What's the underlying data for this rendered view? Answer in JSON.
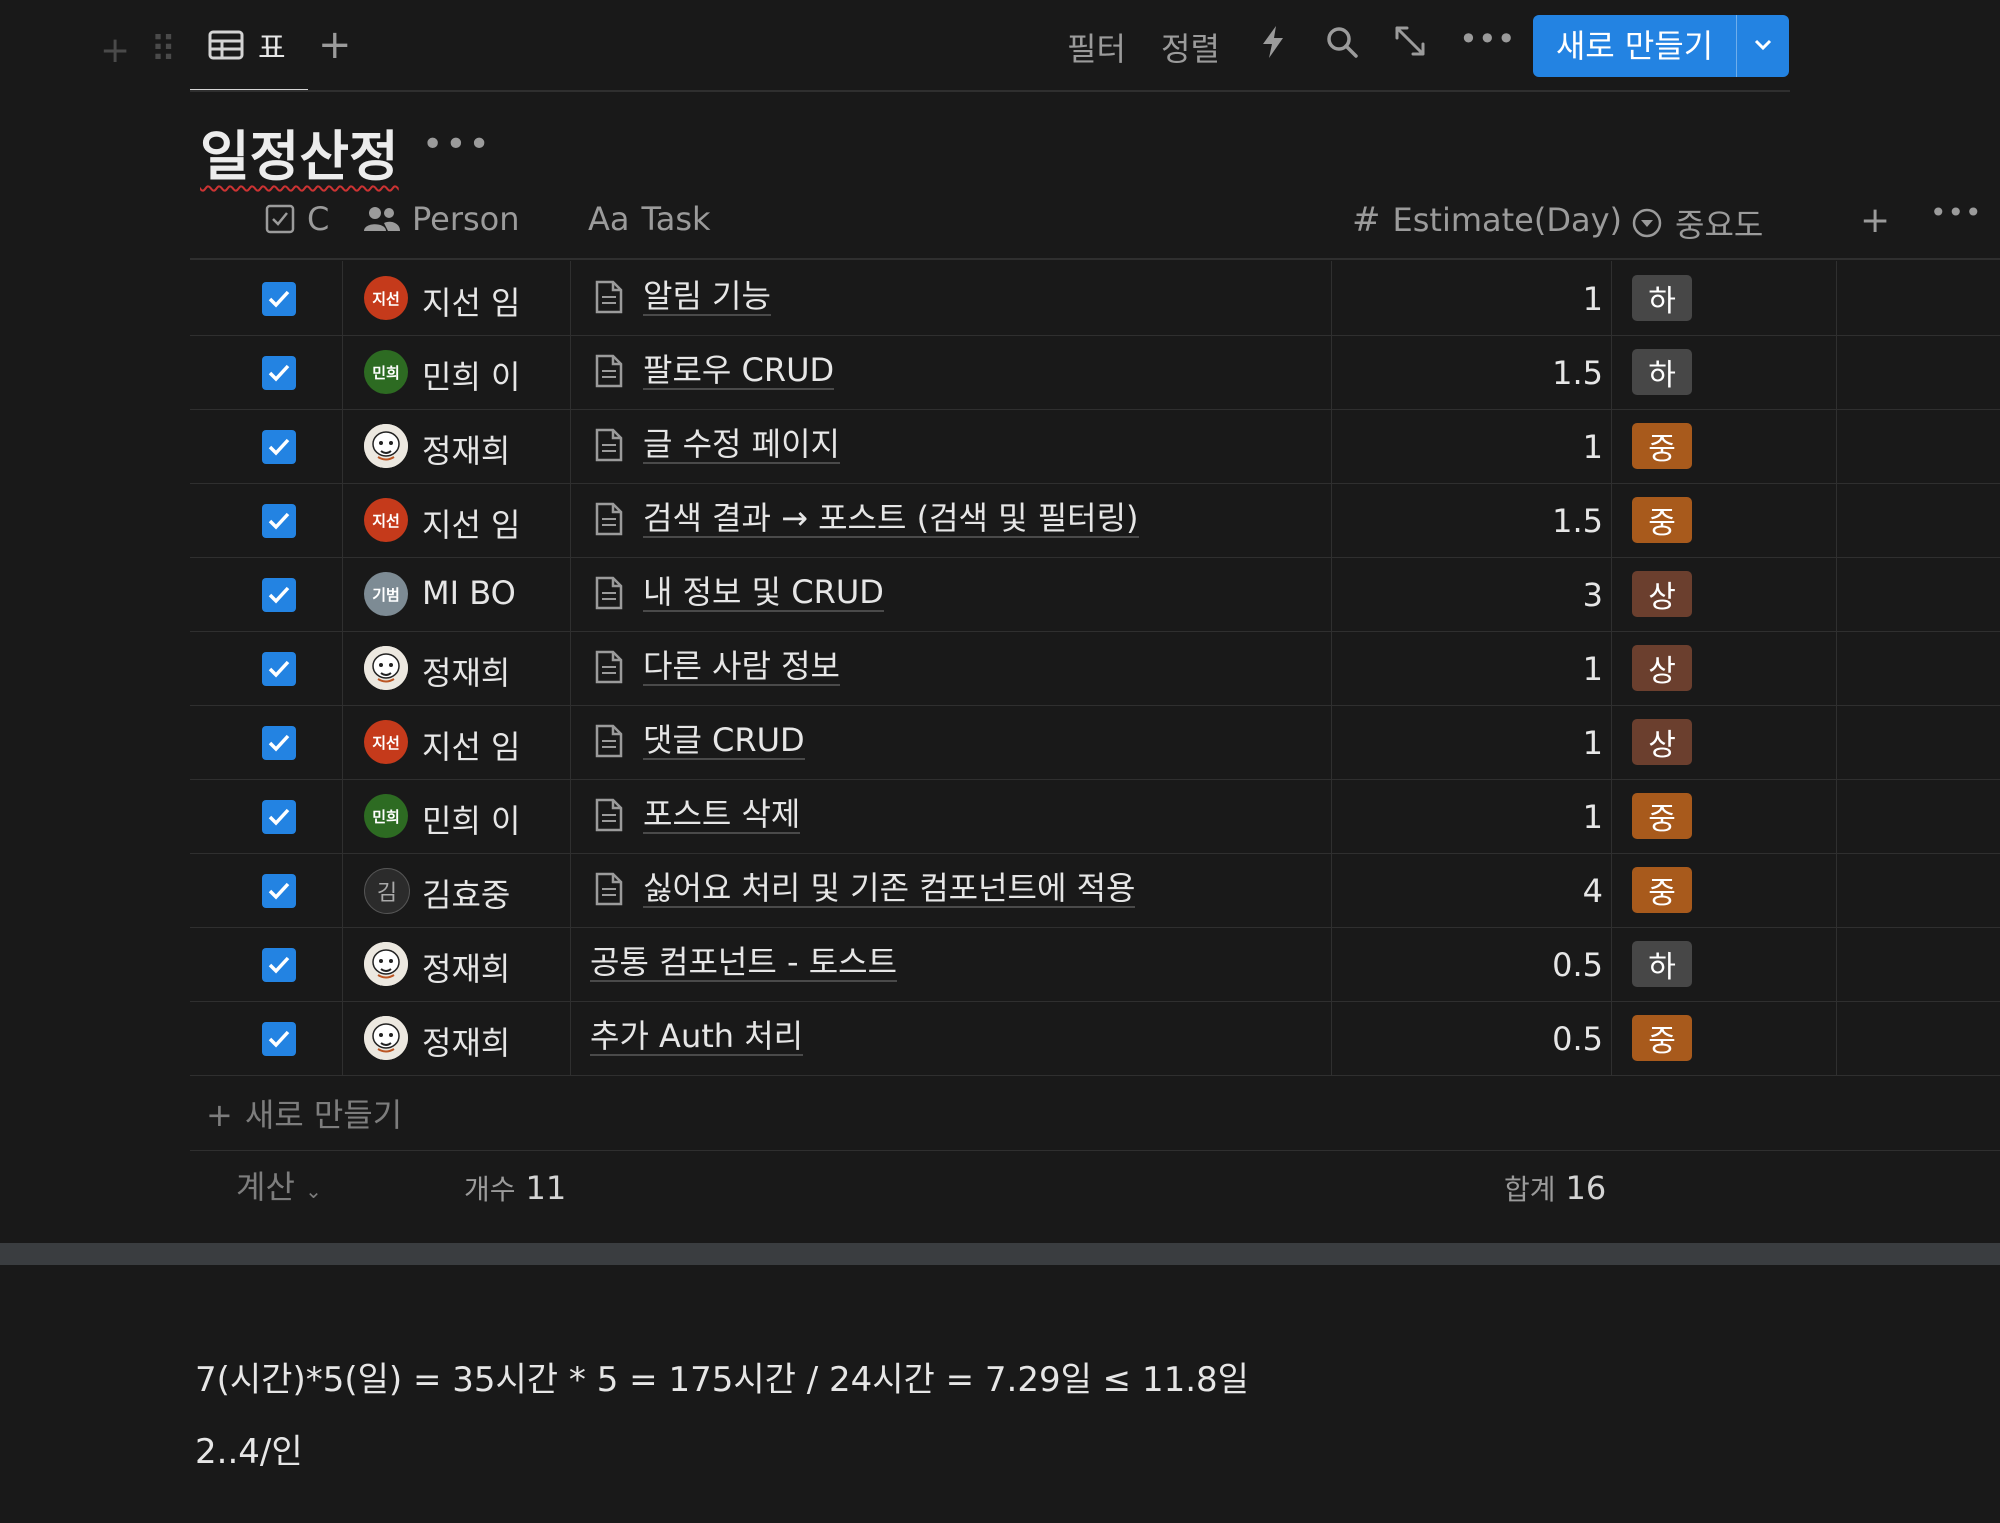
{
  "toolbar": {
    "view_label": "표",
    "filter_label": "필터",
    "sort_label": "정렬",
    "new_label": "새로 만들기"
  },
  "database": {
    "title": "일정산정"
  },
  "columns": {
    "check": "C",
    "person": "Person",
    "task_prefix": "Aa",
    "task": "Task",
    "estimate": "Estimate(Day)",
    "priority": "중요도"
  },
  "rows": [
    {
      "checked": true,
      "avatar_text": "지선",
      "avatar_color": "#c53a1b",
      "person": "지선 임",
      "task": "알림 기능",
      "has_doc": true,
      "estimate": "1",
      "priority": "하",
      "priority_color": "#474747"
    },
    {
      "checked": true,
      "avatar_text": "민희",
      "avatar_color": "#2d6b22",
      "person": "민희 이",
      "task": "팔로우 CRUD",
      "has_doc": true,
      "estimate": "1.5",
      "priority": "하",
      "priority_color": "#474747"
    },
    {
      "checked": true,
      "avatar_text": "",
      "avatar_color": "#f0ede6",
      "person": "정재희",
      "task": "글 수정 페이지",
      "has_doc": true,
      "estimate": "1",
      "priority": "중",
      "priority_color": "#a85a1c"
    },
    {
      "checked": true,
      "avatar_text": "지선",
      "avatar_color": "#c53a1b",
      "person": "지선 임",
      "task": "검색 결과 → 포스트 (검색 및 필터링)",
      "has_doc": true,
      "estimate": "1.5",
      "priority": "중",
      "priority_color": "#a85a1c"
    },
    {
      "checked": true,
      "avatar_text": "기범",
      "avatar_color": "#7d8b94",
      "person": "MI BO",
      "task": "내 정보 및 CRUD",
      "has_doc": true,
      "estimate": "3",
      "priority": "상",
      "priority_color": "#6b3f2e"
    },
    {
      "checked": true,
      "avatar_text": "",
      "avatar_color": "#f0ede6",
      "person": "정재희",
      "task": "다른 사람 정보",
      "has_doc": true,
      "estimate": "1",
      "priority": "상",
      "priority_color": "#6b3f2e"
    },
    {
      "checked": true,
      "avatar_text": "지선",
      "avatar_color": "#c53a1b",
      "person": "지선 임",
      "task": "댓글 CRUD",
      "has_doc": true,
      "estimate": "1",
      "priority": "상",
      "priority_color": "#6b3f2e"
    },
    {
      "checked": true,
      "avatar_text": "민희",
      "avatar_color": "#2d6b22",
      "person": "민희 이",
      "task": "포스트 삭제",
      "has_doc": true,
      "estimate": "1",
      "priority": "중",
      "priority_color": "#a85a1c"
    },
    {
      "checked": true,
      "avatar_text": "김",
      "avatar_color": "#2b2b2b",
      "person": "김효중",
      "task": "싫어요 처리 및 기존 컴포넌트에 적용",
      "has_doc": true,
      "estimate": "4",
      "priority": "중",
      "priority_color": "#a85a1c"
    },
    {
      "checked": true,
      "avatar_text": "",
      "avatar_color": "#f0ede6",
      "person": "정재희",
      "task": "공통 컴포넌트 - 토스트",
      "has_doc": false,
      "estimate": "0.5",
      "priority": "하",
      "priority_color": "#474747"
    },
    {
      "checked": true,
      "avatar_text": "",
      "avatar_color": "#f0ede6",
      "person": "정재희",
      "task": "추가 Auth 처리",
      "has_doc": false,
      "estimate": "0.5",
      "priority": "중",
      "priority_color": "#a85a1c"
    }
  ],
  "new_row_label": "새로 만들기",
  "footer": {
    "calc_label": "계산",
    "count_label": "개수",
    "count_value": "11",
    "sum_label": "합계",
    "sum_value": "16"
  },
  "notes": {
    "line1": "7(시간)*5(일) = 35시간 * 5 = 175시간 / 24시간 = 7.29일 ≤ 11.8일",
    "line2": "2..4/인"
  },
  "colors": {
    "background": "#191919",
    "accent": "#2383e2"
  }
}
